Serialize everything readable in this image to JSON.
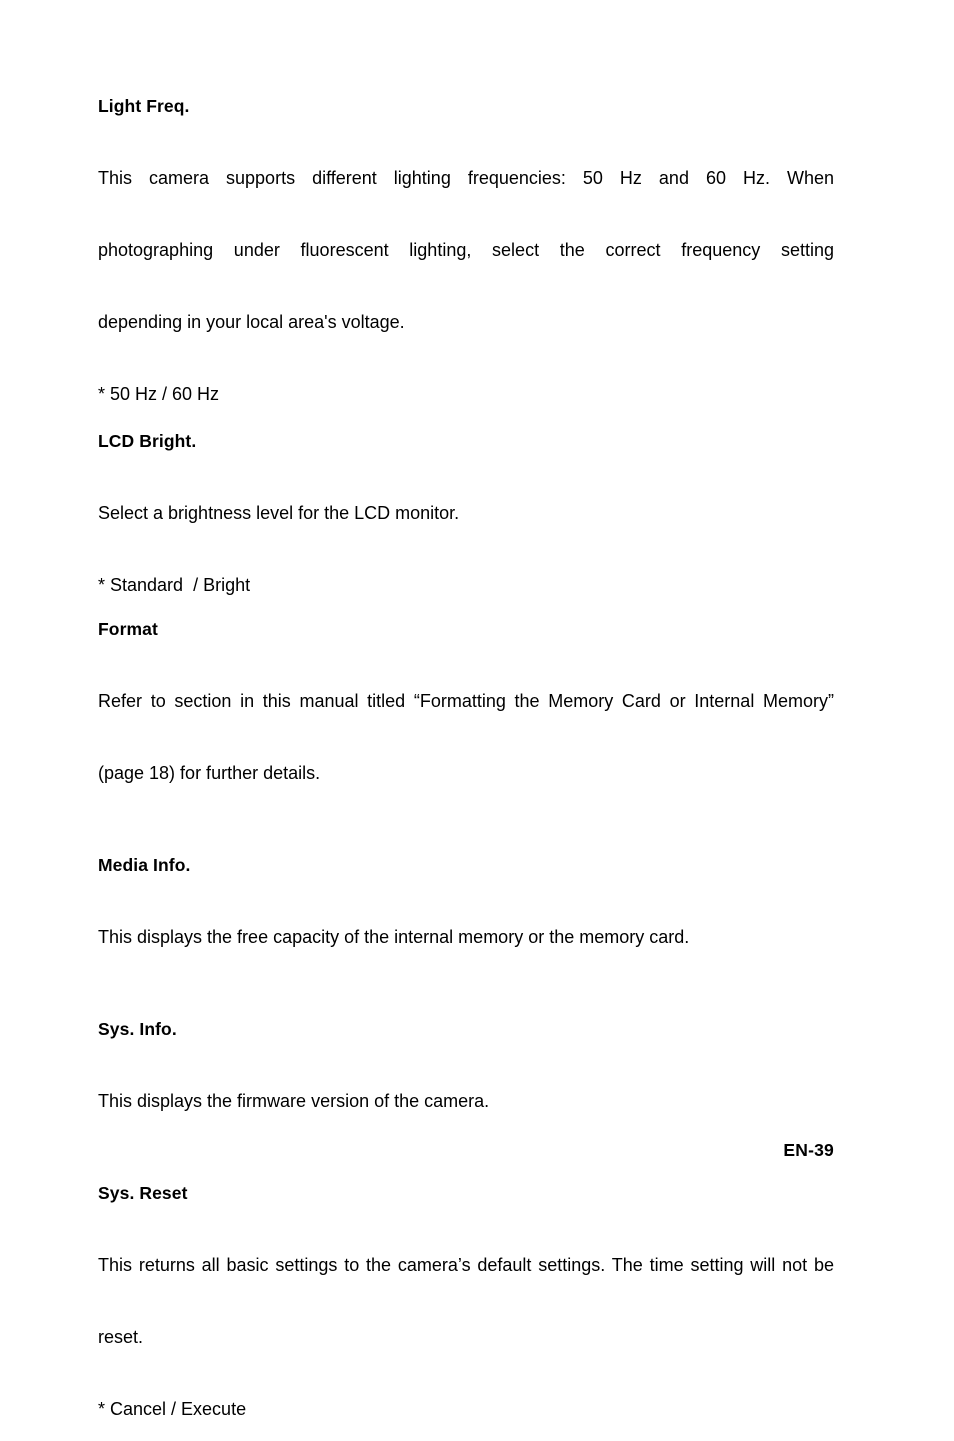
{
  "page": {
    "footer_label": "EN-39"
  },
  "sections": [
    {
      "heading": "Light Freq.",
      "body_lines": [
        "This camera supports different lighting frequencies: 50 Hz and 60 Hz. When",
        "photographing under fluorescent lighting, select the correct frequency setting",
        "depending in your local area's voltage."
      ],
      "options": "* 50 Hz / 60 Hz"
    },
    {
      "heading": "LCD Bright.",
      "body_lines": [
        "Select a brightness level for the LCD monitor."
      ],
      "options": "* Standard  / Bright"
    },
    {
      "heading": "Format",
      "body_lines": [
        "Refer to section in this manual titled “Formatting the Memory Card or Internal Memory”",
        "(page 18) for further details."
      ],
      "options": ""
    },
    {
      "heading": "Media Info.",
      "body_lines": [
        "This displays the free capacity of the internal memory or the memory card."
      ],
      "options": ""
    },
    {
      "heading": "Sys. Info.",
      "body_lines": [
        "This displays the firmware version of the camera."
      ],
      "options": ""
    },
    {
      "heading": "Sys. Reset",
      "body_lines": [
        "This returns all basic settings to the camera’s default settings. The time setting will not be",
        "reset."
      ],
      "options": "* Cancel / Execute"
    }
  ]
}
